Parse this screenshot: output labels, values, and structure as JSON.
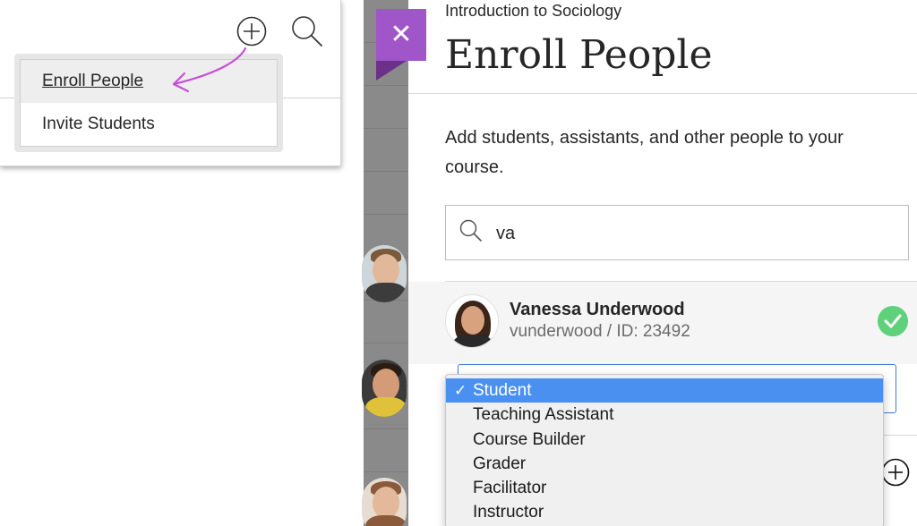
{
  "left_menu": {
    "items": [
      {
        "label": "Enroll People",
        "active": true
      },
      {
        "label": "Invite Students",
        "active": false
      }
    ]
  },
  "panel": {
    "course_title": "Introduction to Sociology",
    "title": "Enroll People",
    "description": "Add students, assistants, and other people to your course.",
    "search": {
      "value": "va"
    },
    "result": {
      "name": "Vanessa Underwood",
      "username": "vunderwood",
      "id_text": " / ID: 23492"
    },
    "role_options": [
      {
        "label": "Student",
        "selected": true
      },
      {
        "label": "Teaching Assistant",
        "selected": false
      },
      {
        "label": "Course Builder",
        "selected": false
      },
      {
        "label": "Grader",
        "selected": false
      },
      {
        "label": "Facilitator",
        "selected": false
      },
      {
        "label": "Instructor",
        "selected": false
      }
    ]
  },
  "colors": {
    "accent_purple": "#a056c8",
    "check_green": "#5fd17a",
    "select_blue": "#4a90f0",
    "arrow_magenta": "#c84fd8"
  },
  "icons": [
    "plus-circle-icon",
    "search-icon",
    "close-icon",
    "checkmark-icon",
    "add-circle-icon",
    "arrow-annotation"
  ]
}
